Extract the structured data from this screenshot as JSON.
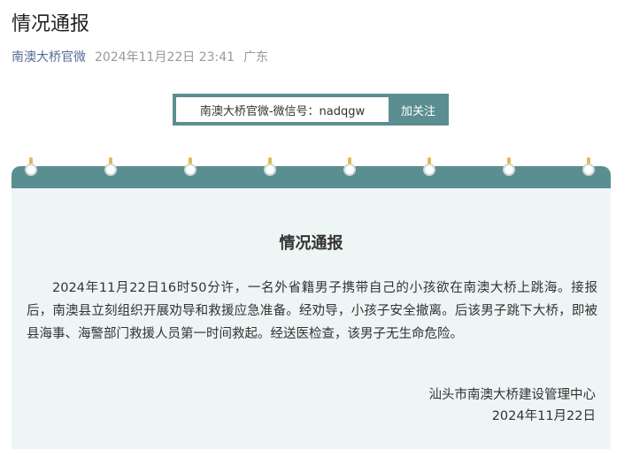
{
  "article": {
    "title": "情况通报",
    "account": "南澳大桥官微",
    "time": "2024年11月22日 23:41",
    "location": "广东"
  },
  "follow_bar": {
    "text": "南澳大桥官微-微信号：nadqgw",
    "button": "加关注"
  },
  "notice": {
    "title": "情况通报",
    "paragraph": "2024年11月22日16时50分许，一名外省籍男子携带自己的小孩欲在南澳大桥上跳海。接报后，南澳县立刻组织开展劝导和救援应急准备。经劝导，小孩子安全撤离。后该男子跳下大桥，即被县海事、海警部门救援人员第一时间救起。经送医检查，该男子无生命危险。",
    "signature_org": "汕头市南澳大桥建设管理中心",
    "signature_date": "2024年11月22日"
  },
  "theme": {
    "accent": "#5b8e91",
    "ring_color": "#e6b94a",
    "card_background": "#eef5f5"
  }
}
